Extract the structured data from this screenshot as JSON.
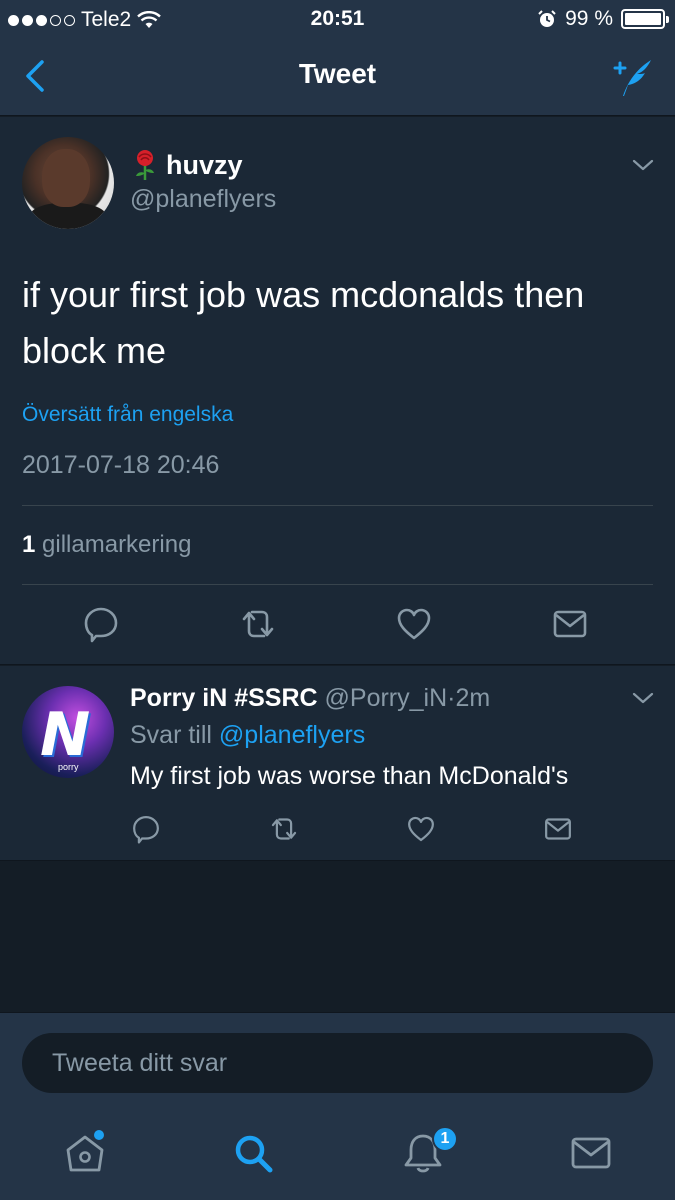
{
  "status_bar": {
    "carrier": "Tele2",
    "time": "20:51",
    "battery_percent": "99 %",
    "battery_level": 0.99
  },
  "nav": {
    "title": "Tweet",
    "back_icon": "chevron-left-icon",
    "compose_icon": "compose-tweet-icon"
  },
  "tweet": {
    "author_name": "huvzy",
    "author_emoji": "rose-icon",
    "author_handle": "@planeflyers",
    "text": "if your first job was mcdonalds then block me",
    "translate_label": "Översätt från engelska",
    "timestamp": "2017-07-18 20:46",
    "likes_count": "1",
    "likes_label": "gillamarkering"
  },
  "reply": {
    "author_name": "Porry iN #SSRC",
    "author_handle": "@Porry_iN",
    "separator": "·",
    "age": "2m",
    "reply_to_prefix": "Svar till",
    "reply_to_handle": "@planeflyers",
    "text": "My first job was worse than McDonald's",
    "avatar_tag": "porry"
  },
  "compose": {
    "placeholder": "Tweeta ditt svar"
  },
  "tabbar": {
    "notifications_badge": "1"
  },
  "colors": {
    "background": "#141d26",
    "card": "#1b2836",
    "bar": "#243447",
    "accent": "#1da1f2",
    "secondary_text": "#8899a6"
  }
}
